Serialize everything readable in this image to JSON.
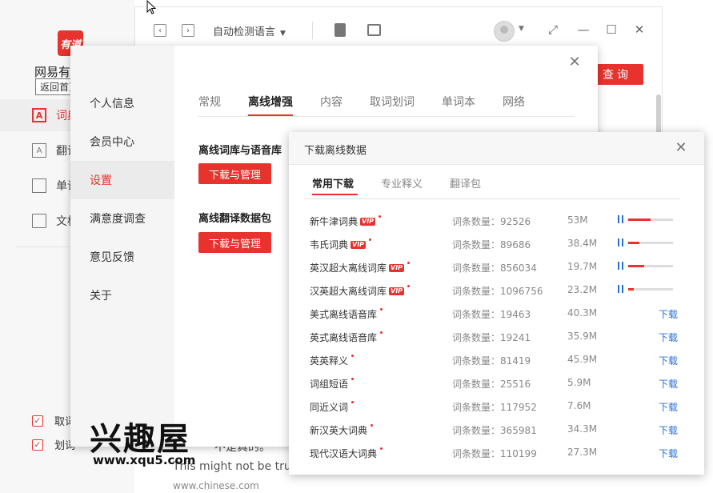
{
  "app": {
    "logo_text": "有道",
    "name": "网易有道词典",
    "home_tooltip": "返回首页"
  },
  "sidebar": {
    "items": [
      {
        "label": "词典",
        "icon": "dictionary-icon"
      },
      {
        "label": "翻译",
        "icon": "translate-icon"
      },
      {
        "label": "单词本",
        "icon": "wordbook-icon"
      },
      {
        "label": "文档翻译",
        "icon": "document-icon"
      }
    ],
    "checks": [
      {
        "label": "取词",
        "checked": true
      },
      {
        "label": "划词",
        "checked": true
      }
    ]
  },
  "toolbar": {
    "back_icon": "chevron-left-icon",
    "forward_icon": "chevron-right-icon",
    "language": "自动检测语言",
    "query_button": "查询"
  },
  "main": {
    "example_fragment": "不是真的。",
    "example_sentence": "This might not be true.",
    "example_source": "www.chinese.com"
  },
  "settings": {
    "nav": [
      "个人信息",
      "会员中心",
      "设置",
      "满意度调查",
      "意见反馈",
      "关于"
    ],
    "nav_active": 2,
    "tabs": [
      "常规",
      "离线增强",
      "内容",
      "取词划词",
      "单词本",
      "网络"
    ],
    "tab_active": 1,
    "section1_title": "离线词库与语音库",
    "section1_button": "下载与管理",
    "section2_title": "离线翻译数据包",
    "section2_button": "下载与管理"
  },
  "download": {
    "title": "下载离线数据",
    "tabs": [
      "常用下载",
      "专业释义",
      "翻译包"
    ],
    "tab_active": 0,
    "count_prefix": "词条数量：",
    "vip_label": "VIP",
    "download_label": "下载",
    "rows": [
      {
        "name": "新牛津词典",
        "vip": true,
        "count": "92526",
        "size": "53M",
        "state": "downloading",
        "progress": 0.5
      },
      {
        "name": "韦氏词典",
        "vip": true,
        "count": "89686",
        "size": "38.4M",
        "state": "downloading",
        "progress": 0.25
      },
      {
        "name": "英汉超大离线词库",
        "vip": true,
        "count": "856034",
        "size": "19.7M",
        "state": "downloading",
        "progress": 0.35
      },
      {
        "name": "汉英超大离线词库",
        "vip": true,
        "count": "1096756",
        "size": "23.2M",
        "state": "downloading",
        "progress": 0.12
      },
      {
        "name": "美式离线语音库",
        "vip": false,
        "count": "19463",
        "size": "40.3M",
        "state": "download"
      },
      {
        "name": "英式离线语音库",
        "vip": false,
        "count": "19241",
        "size": "35.9M",
        "state": "download"
      },
      {
        "name": "英英释义",
        "vip": false,
        "count": "81419",
        "size": "45.9M",
        "state": "download"
      },
      {
        "name": "词组短语",
        "vip": false,
        "count": "25516",
        "size": "5.9M",
        "state": "download"
      },
      {
        "name": "同近义词",
        "vip": false,
        "count": "117952",
        "size": "7.6M",
        "state": "download"
      },
      {
        "name": "新汉英大词典",
        "vip": false,
        "count": "365981",
        "size": "34.3M",
        "state": "download"
      },
      {
        "name": "现代汉语大词典",
        "vip": false,
        "count": "110199",
        "size": "27.3M",
        "state": "download"
      }
    ]
  },
  "watermark": {
    "logo": "兴趣屋",
    "url": "www.xqu5.com"
  }
}
